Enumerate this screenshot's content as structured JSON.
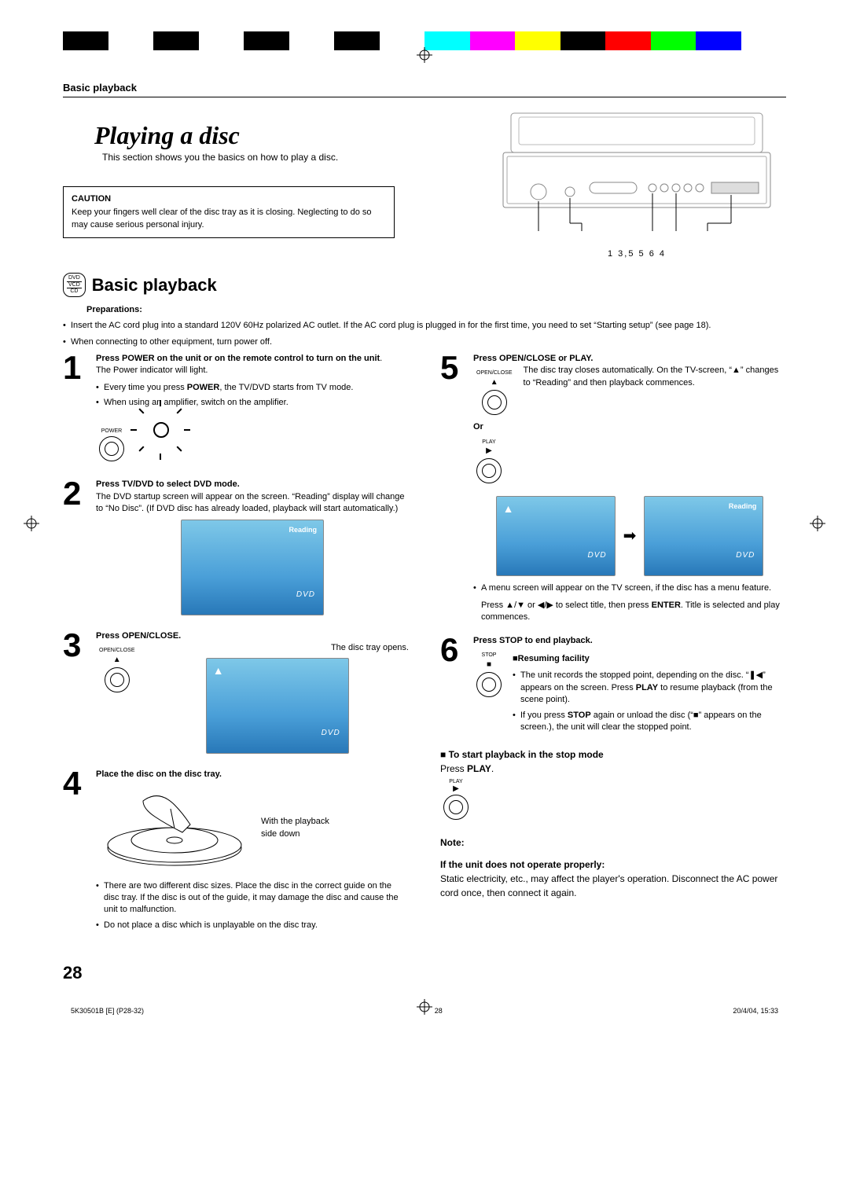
{
  "header": {
    "crumb": "Basic playback"
  },
  "title": "Playing a disc",
  "subtitle": "This section shows you the basics on how to play a disc.",
  "caution": {
    "heading": "CAUTION",
    "body": "Keep your fingers well clear of the disc tray as it is closing. Neglecting to do so may cause serious personal injury."
  },
  "diagram_labels": "1  3,5      5  6   4",
  "disc_types": [
    "DVD",
    "VCD",
    "CD"
  ],
  "section_heading": "Basic playback",
  "preparations": {
    "heading": "Preparations:",
    "items": [
      "Insert the AC cord plug into a standard 120V 60Hz polarized AC outlet. If the AC cord plug is plugged in for the first time, you need to set “Starting setup” (see page 18).",
      "When connecting to other equipment, turn power off."
    ]
  },
  "steps": {
    "s1": {
      "num": "1",
      "bold": "Press POWER on the unit or on the remote control to turn on the unit",
      "line1": "The Power indicator will light.",
      "b1": "Every time you press ",
      "b1b": "POWER",
      "b1c": ", the TV/DVD starts from TV mode.",
      "b2": "When using an amplifier, switch on the amplifier.",
      "btn": "POWER"
    },
    "s2": {
      "num": "2",
      "bold": "Press TV/DVD to select DVD mode.",
      "body": "The DVD startup screen will appear on the screen. “Reading” display will change to “No Disc”. (If DVD disc has already loaded, playback will start automatically.)",
      "screen_reading": "Reading",
      "screen_dvd": "DVD"
    },
    "s3": {
      "num": "3",
      "bold": "Press OPEN/CLOSE.",
      "line": "The disc tray opens.",
      "btn": "OPEN/CLOSE",
      "eject": "▲"
    },
    "s4": {
      "num": "4",
      "bold": "Place the disc on the disc tray.",
      "caption": "With the playback side down",
      "b1": "There are two different disc sizes. Place the disc in the correct guide on the disc tray. If the disc is out of the guide, it may damage the disc and cause the unit to malfunction.",
      "b2": "Do not place a disc which is unplayable on the disc tray."
    },
    "s5": {
      "num": "5",
      "bold": "Press OPEN/CLOSE or PLAY.",
      "body": "The disc tray closes automatically. On the TV-screen, “▲” changes to “Reading” and then playback commences.",
      "or": "Or",
      "btn1": "OPEN/CLOSE",
      "btn2": "PLAY",
      "screen_eject": "▲",
      "screen_reading": "Reading",
      "after1": "A menu screen will appear on the TV screen, if the disc has a menu feature.",
      "after2a": "Press ▲/▼ or ◀/▶ to select title, then press ",
      "after2b": "ENTER",
      "after2c": ". Title is selected and play commences."
    },
    "s6": {
      "num": "6",
      "bold": "Press STOP to end playback.",
      "btn": "STOP",
      "resume_h": "■Resuming facility",
      "r1a": "The unit records the stopped point, depending on the disc. “❚◀” appears on the screen. Press ",
      "r1b": "PLAY",
      "r1c": " to resume playback (from the scene point).",
      "r2a": "If you press ",
      "r2b": "STOP",
      "r2c": " again or unload the disc (“■” appears on the screen.), the unit will clear the stopped point."
    }
  },
  "restart": {
    "heading": "■ To start playback in the stop mode",
    "body_a": "Press ",
    "body_b": "PLAY",
    "body_c": ".",
    "btn": "PLAY"
  },
  "note": {
    "heading": "Note:",
    "sub": "If the unit does not operate properly:",
    "body": "Static electricity, etc., may affect the player's operation. Disconnect the AC power cord once, then connect it again."
  },
  "page_number": "28",
  "footer": {
    "left": "5K30501B [E] (P28-32)",
    "mid": "28",
    "right": "20/4/04, 15:33"
  },
  "colors": [
    "#000",
    "#fff",
    "#000",
    "#fff",
    "#000",
    "#fff",
    "#000",
    "#fff",
    "#0ff",
    "#f0f",
    "#ff0",
    "#000",
    "#f00",
    "#0f0",
    "#00f",
    "#fff"
  ]
}
